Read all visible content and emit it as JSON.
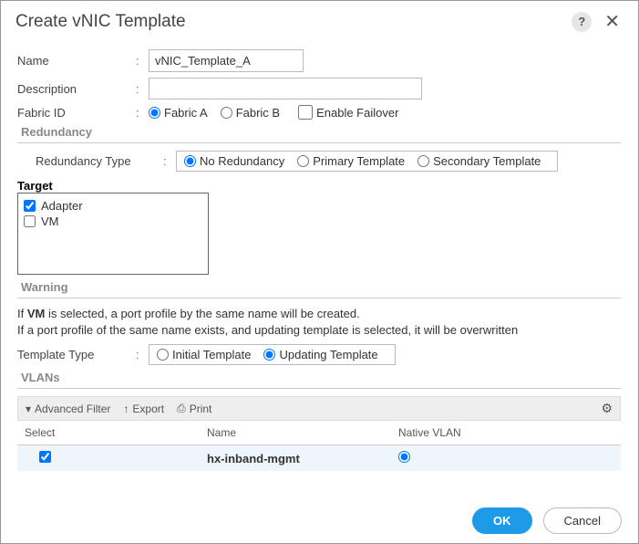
{
  "dialog": {
    "title": "Create vNIC Template"
  },
  "fields": {
    "name_label": "Name",
    "name_value": "vNIC_Template_A",
    "desc_label": "Description",
    "desc_value": "",
    "fabric_label": "Fabric ID",
    "fabric_a": "Fabric A",
    "fabric_b": "Fabric B",
    "enable_failover": "Enable Failover"
  },
  "redundancy": {
    "section": "Redundancy",
    "type_label": "Redundancy Type",
    "no_redun": "No Redundancy",
    "primary": "Primary Template",
    "secondary": "Secondary Template"
  },
  "target": {
    "header": "Target",
    "adapter": "Adapter",
    "vm": "VM"
  },
  "warning": {
    "section": "Warning",
    "line1a": "If ",
    "line1b": "VM",
    "line1c": " is selected, a port profile by the same name will be created.",
    "line2": "If a port profile of the same name exists, and updating template is selected, it will be overwritten"
  },
  "template_type": {
    "label": "Template Type",
    "initial": "Initial Template",
    "updating": "Updating Template"
  },
  "vlans": {
    "section": "VLANs",
    "adv_filter": "Advanced Filter",
    "export": "Export",
    "print": "Print",
    "col_select": "Select",
    "col_name": "Name",
    "col_native": "Native VLAN",
    "row1_name": "hx-inband-mgmt"
  },
  "buttons": {
    "ok": "OK",
    "cancel": "Cancel"
  }
}
